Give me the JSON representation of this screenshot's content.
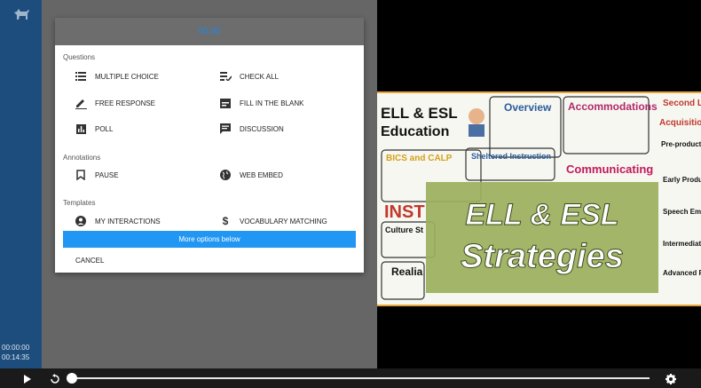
{
  "dialog": {
    "timer": "00:00",
    "sections": {
      "questions": "Questions",
      "annotations": "Annotations",
      "templates": "Templates"
    },
    "options": {
      "multiple_choice": "MULTIPLE CHOICE",
      "check_all": "CHECK ALL",
      "free_response": "FREE RESPONSE",
      "fill_blank": "FILL IN THE BLANK",
      "poll": "POLL",
      "discussion": "DISCUSSION",
      "pause": "PAUSE",
      "web_embed": "WEB EMBED",
      "my_interactions": "MY INTERACTIONS",
      "vocab_matching": "VOCABULARY MATCHING"
    },
    "more_options": "More options below",
    "cancel": "CANCEL"
  },
  "sidebar": {
    "current_time": "00:00:00",
    "duration": "00:14:35"
  },
  "video": {
    "title_line1": "ELL & ESL",
    "title_line2": "Strategies",
    "thumb_words": {
      "ell_esl": "ELL & ESL",
      "education": "Education",
      "overview": "Overview",
      "accommodations": "Accommodations",
      "second_language": "Second Language",
      "acquisition": "Acquisition",
      "bics_calp": "BICS and CALP",
      "sheltered": "Sheltered Instruction",
      "communicating": "Communicating",
      "culture": "Culture St",
      "realia": "Realia",
      "instr": "INST",
      "preproduction": "Pre-production",
      "early": "Early Production",
      "speech": "Speech Emergence",
      "intermediate": "Intermediate Fluency",
      "advanced": "Advanced Fluency"
    }
  },
  "colors": {
    "accent": "#2196f3",
    "sidebar": "#1d4d7d",
    "banner": "#9caf5e"
  }
}
